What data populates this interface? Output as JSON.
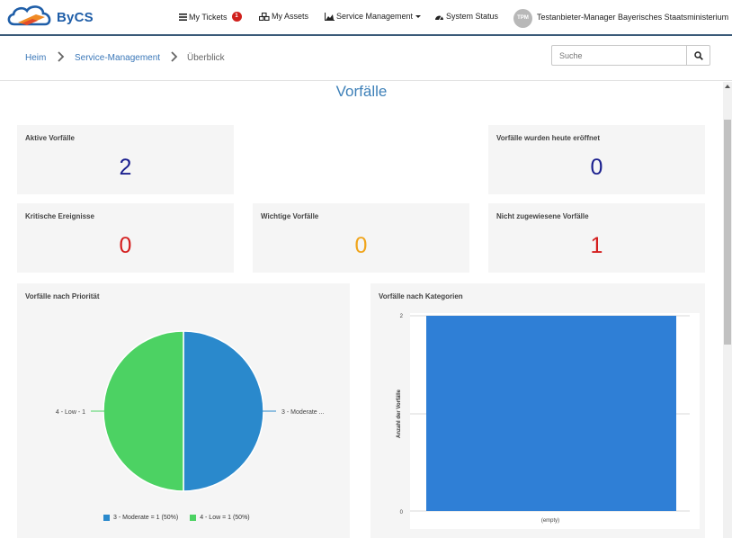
{
  "brand": {
    "name": "ByCS"
  },
  "nav": {
    "my_tickets": "My Tickets",
    "my_tickets_count": "1",
    "my_assets": "My Assets",
    "service_management": "Service Management",
    "system_status": "System Status",
    "user_initials": "TPM",
    "user_name": "Testanbieter-Manager Bayerisches Staatsministerium"
  },
  "breadcrumb": {
    "home": "Heim",
    "service_management": "Service-Management",
    "current": "Überblick"
  },
  "search": {
    "placeholder": "Suche"
  },
  "page": {
    "title": "Vorfälle"
  },
  "colors": {
    "navy": "#1a1f8e",
    "red": "#d41e1e",
    "orange": "#f0a41a",
    "pie_blue": "#2a89cc",
    "pie_green": "#4cd263",
    "bar_blue": "#2f7fd6"
  },
  "cards": {
    "active": {
      "title": "Aktive Vorfälle",
      "value": "2"
    },
    "opened_today": {
      "title": "Vorfälle wurden heute eröffnet",
      "value": "0"
    },
    "critical": {
      "title": "Kritische Ereignisse",
      "value": "0"
    },
    "important": {
      "title": "Wichtige Vorfälle",
      "value": "0"
    },
    "unassigned": {
      "title": "Nicht zugewiesene Vorfälle",
      "value": "1"
    }
  },
  "priority_panel": {
    "title": "Vorfälle nach Priorität",
    "label_left": "4 - Low - 1",
    "label_right": "3 - Moderate ...",
    "legend": [
      {
        "label": "3 - Moderate = 1 (50%)",
        "color": "#2a89cc"
      },
      {
        "label": "4 - Low = 1 (50%)",
        "color": "#4cd263"
      }
    ]
  },
  "category_panel": {
    "title": "Vorfälle nach Kategorien",
    "ylabel": "Anzahl der Vorfälle",
    "category": "(empty)",
    "ytick_top": "2",
    "ytick_bottom": "0"
  },
  "chart_data": [
    {
      "type": "pie",
      "title": "Vorfälle nach Priorität",
      "categories": [
        "3 - Moderate",
        "4 - Low"
      ],
      "values": [
        1,
        1
      ],
      "legend": "bottom"
    },
    {
      "type": "bar",
      "title": "Vorfälle nach Kategorien",
      "categories": [
        "(empty)"
      ],
      "values": [
        2
      ],
      "ylabel": "Anzahl der Vorfälle",
      "ylim": [
        0,
        2
      ],
      "grid": true
    }
  ]
}
